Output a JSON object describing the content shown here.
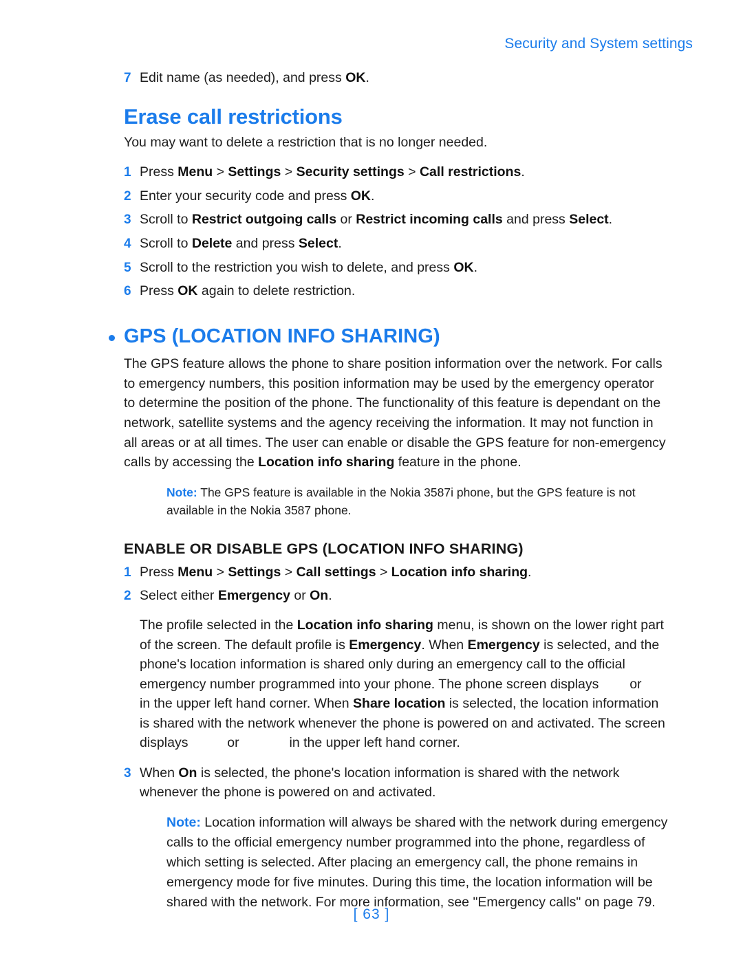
{
  "document": {
    "running_header": "Security and System settings",
    "page_number": "[ 63 ]",
    "accent_color": "#1b7ceb",
    "text_color": "#1d1d1d",
    "background_color": "#ffffff"
  },
  "carryover_step": {
    "number": "7",
    "text_pre": "Edit name (as needed), and press ",
    "bold_1": "OK",
    "text_post": "."
  },
  "section_erase": {
    "heading": "Erase call restrictions",
    "intro": "You may want to delete a restriction that is no longer needed.",
    "steps": [
      {
        "number": "1",
        "pre": "Press ",
        "b1": "Menu",
        "mid1": " > ",
        "b2": "Settings",
        "mid2": " > ",
        "b3": "Security settings",
        "mid3": " > ",
        "b4": "Call restrictions",
        "post": "."
      },
      {
        "number": "2",
        "pre": "Enter your security code and press ",
        "b1": "OK",
        "post": "."
      },
      {
        "number": "3",
        "pre": "Scroll to ",
        "b1": "Restrict outgoing calls",
        "mid1": " or ",
        "b2": "Restrict incoming calls",
        "mid2": " and press ",
        "b3": "Select",
        "post": "."
      },
      {
        "number": "4",
        "pre": "Scroll to ",
        "b1": "Delete",
        "mid1": " and press ",
        "b2": "Select",
        "post": "."
      },
      {
        "number": "5",
        "pre": "Scroll to the restriction you wish to delete, and press ",
        "b1": "OK",
        "post": "."
      },
      {
        "number": "6",
        "pre": "Press ",
        "b1": "OK",
        "post": " again to delete restriction."
      }
    ]
  },
  "section_gps": {
    "heading": "GPS (LOCATION INFO SHARING)",
    "bullet": "•",
    "intro_pre": "The GPS feature allows the phone to share position information over the network. For calls to emergency numbers, this position information may be used by the emergency operator to determine the position of the phone. The functionality of this feature is dependant on the network, satellite systems and the agency receiving the information. It may not function in all areas or at all times. The user can enable or disable the GPS feature for non-emergency calls by accessing the ",
    "intro_bold": "Location info sharing",
    "intro_post": " feature in the phone.",
    "note_1": {
      "label": "Note:",
      "text": " The GPS feature is available in the Nokia 3587i phone, but the GPS feature is not available in the Nokia 3587 phone."
    },
    "subheading": "ENABLE OR DISABLE GPS (LOCATION INFO SHARING)",
    "steps": [
      {
        "number": "1",
        "pre": "Press ",
        "b1": "Menu",
        "mid1": " > ",
        "b2": "Settings",
        "mid2": " > ",
        "b3": "Call settings",
        "mid3": " > ",
        "b4": "Location info sharing",
        "post": "."
      },
      {
        "number": "2",
        "pre": "Select either ",
        "b1": "Emergency",
        "mid1": " or ",
        "b2": "On",
        "post": "."
      }
    ],
    "profile_paragraph": {
      "p1": "The profile selected in the ",
      "b1": "Location info sharing",
      "p2": " menu, is shown on the lower right part of the screen. The default profile is ",
      "b2": "Emergency",
      "p3": ". When ",
      "b3": "Emergency",
      "p4": " is selected, and the phone's location information is shared only during an emergency call to the official emergency number programmed into your phone. The phone screen displays ",
      "p5": " or ",
      "p6": " in the upper left hand corner. When ",
      "b4": "Share location",
      "p7": " is selected, the location information is shared with the network whenever the phone is powered on and activated. The screen displays ",
      "p8": " or ",
      "p9": " in the upper left hand corner."
    },
    "step_3": {
      "number": "3",
      "pre": "When ",
      "b1": "On",
      "post": " is selected, the phone's location information is shared with the network whenever the phone is powered on and activated."
    },
    "note_2": {
      "label": "Note:",
      "text": " Location information will always be shared with the network during emergency calls to the official emergency number programmed into the phone, regardless of which setting is selected. After placing an emergency call, the phone remains in emergency mode for five minutes. During this time, the location information will be shared with the network. For more information, see \"Emergency calls\" on page 79."
    }
  }
}
